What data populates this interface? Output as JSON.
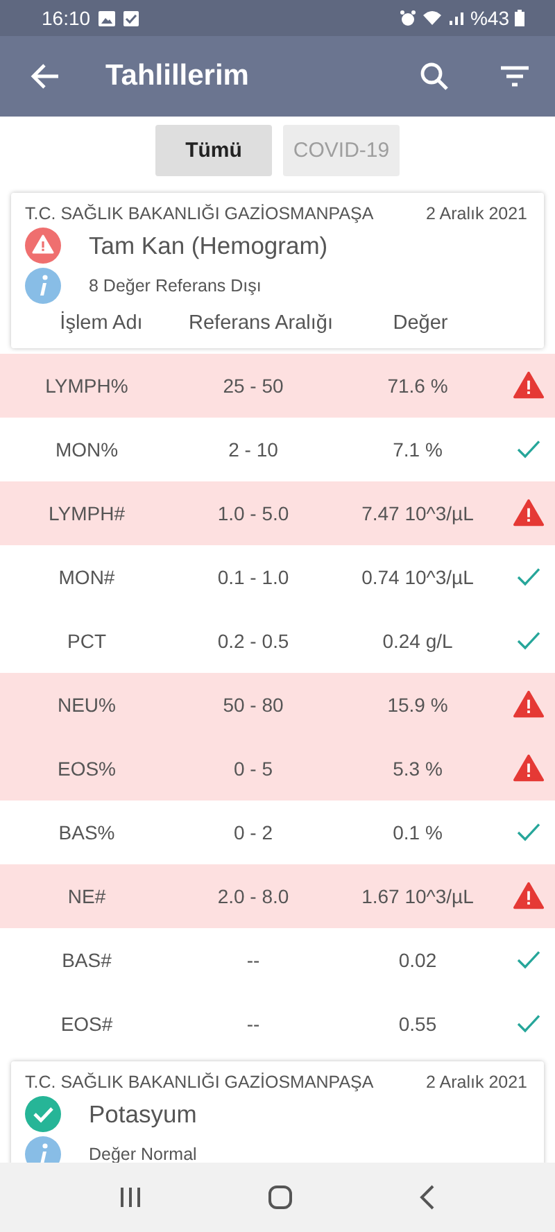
{
  "status_bar": {
    "time": "16:10",
    "battery": "%43"
  },
  "app_bar": {
    "title": "Tahlillerim"
  },
  "tabs": [
    {
      "label": "Tümü",
      "selected": true
    },
    {
      "label": "COVID-19",
      "selected": false
    }
  ],
  "cards": [
    {
      "institution": "T.C. SAĞLIK BAKANLIĞI GAZİOSMANPAŞA",
      "date": "2 Aralık 2021",
      "test": "Tam Kan (Hemogram)",
      "out_of_range": true,
      "note": "8 Değer Referans Dışı",
      "columns": [
        "İşlem Adı",
        "Referans Aralığı",
        "Değer"
      ],
      "rows": [
        {
          "name": "LYMPH%",
          "range": "25 - 50",
          "value": "71.6 %",
          "out_of_range": true
        },
        {
          "name": "MON%",
          "range": "2 - 10",
          "value": "7.1 %",
          "out_of_range": false
        },
        {
          "name": "LYMPH#",
          "range": "1.0 - 5.0",
          "value": "7.47 10^3/µL",
          "out_of_range": true
        },
        {
          "name": "MON#",
          "range": "0.1 - 1.0",
          "value": "0.74 10^3/µL",
          "out_of_range": false
        },
        {
          "name": "PCT",
          "range": "0.2 - 0.5",
          "value": "0.24 g/L",
          "out_of_range": false
        },
        {
          "name": "NEU%",
          "range": "50 - 80",
          "value": "15.9 %",
          "out_of_range": true
        },
        {
          "name": "EOS%",
          "range": "0 - 5",
          "value": "5.3 %",
          "out_of_range": true
        },
        {
          "name": "BAS%",
          "range": "0 - 2",
          "value": "0.1 %",
          "out_of_range": false
        },
        {
          "name": "NE#",
          "range": "2.0 - 8.0",
          "value": "1.67 10^3/µL",
          "out_of_range": true
        },
        {
          "name": "BAS#",
          "range": "--",
          "value": "0.02",
          "out_of_range": false
        },
        {
          "name": "EOS#",
          "range": "--",
          "value": "0.55",
          "out_of_range": false
        }
      ]
    },
    {
      "institution": "T.C. SAĞLIK BAKANLIĞI GAZİOSMANPAŞA",
      "date": "2 Aralık 2021",
      "test": "Potasyum",
      "out_of_range": false,
      "note": "Değer Normal"
    }
  ]
}
